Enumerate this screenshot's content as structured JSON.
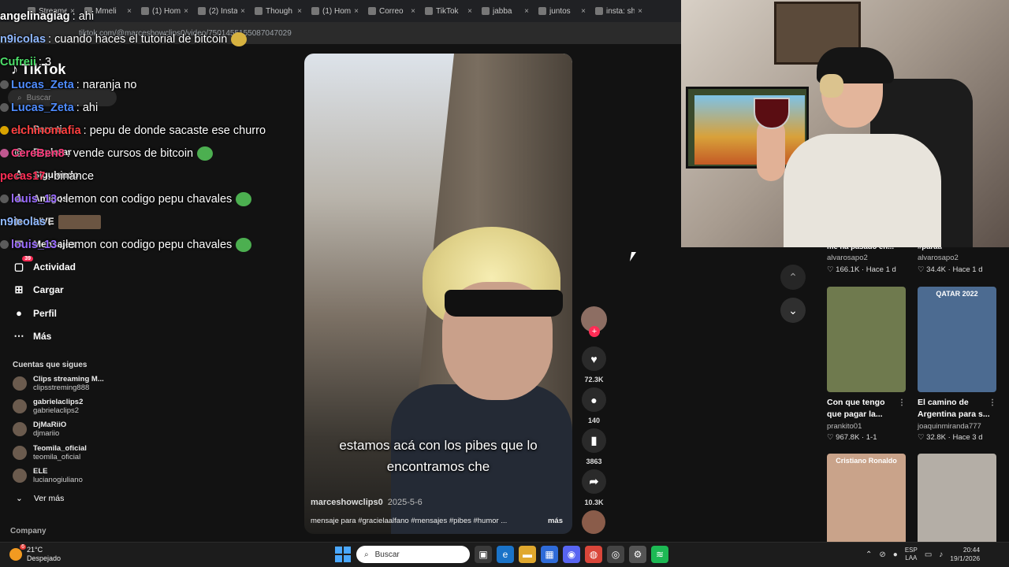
{
  "browser": {
    "tabs": [
      {
        "label": "Streamer",
        "icon": "green-tab-icon"
      },
      {
        "label": "Mmeli",
        "icon": "zz-tab-icon"
      },
      {
        "label": "(1) Hom",
        "icon": "x-tab-icon"
      },
      {
        "label": "(2) Insta",
        "icon": "instagram-tab-icon"
      },
      {
        "label": "Though",
        "icon": "tiktok-tab-icon"
      },
      {
        "label": "(1) Hom",
        "icon": "x-tab-icon"
      },
      {
        "label": "Correo",
        "icon": "tiktok-tab-icon"
      },
      {
        "label": "TikTok",
        "icon": "tiktok-tab-icon"
      },
      {
        "label": "jabba",
        "icon": "google-tab-icon"
      },
      {
        "label": "juntos",
        "icon": "tiktok-tab-icon"
      },
      {
        "label": "insta: sh",
        "icon": "tiktok-tab-icon"
      }
    ],
    "address": "tiktok.com/@marceshowclips0/video/7501455155087047029"
  },
  "tiktok": {
    "logo": "TikTok",
    "search_placeholder": "Buscar",
    "nav": [
      {
        "label": "Para ti",
        "icon": "home-icon"
      },
      {
        "label": "Explorar",
        "icon": "compass-icon"
      },
      {
        "label": "Siguiendo",
        "icon": "following-icon"
      },
      {
        "label": "Amigos",
        "icon": "friends-icon"
      },
      {
        "label": "LIVE",
        "icon": "live-icon"
      },
      {
        "label": "Mensajes",
        "icon": "messages-icon"
      },
      {
        "label": "Actividad",
        "icon": "activity-icon",
        "badge": "39"
      },
      {
        "label": "Cargar",
        "icon": "upload-icon"
      },
      {
        "label": "Perfil",
        "icon": "profile-icon"
      },
      {
        "label": "Más",
        "icon": "more-icon"
      }
    ],
    "following_title": "Cuentas que sigues",
    "following": [
      {
        "name": "Clips streaming M...",
        "handle": "clipsstreming888"
      },
      {
        "name": "gabrielaclips2",
        "handle": "gabrielaclips2"
      },
      {
        "name": "DjMaRiiO",
        "handle": "djmariio",
        "verified": true
      },
      {
        "name": "Teomila_oficial",
        "handle": "teomila_oficial"
      },
      {
        "name": "ELE",
        "handle": "lucianogiuliano"
      }
    ],
    "see_more": "Ver más",
    "company": "Company"
  },
  "chat": [
    {
      "user": "angelinagiag",
      "color": "#ffffff",
      "message": "ahi",
      "badge": "none"
    },
    {
      "user": "n9icolas",
      "color": "#8fb8ff",
      "message": "cuando haces el tutorial de bitcoin",
      "emote": "yellow",
      "badge": "none"
    },
    {
      "user": "Cufreii",
      "color": "#4de06a",
      "message": "3",
      "badge": "none"
    },
    {
      "user": "Lucas_Zeta",
      "color": "#4f8cff",
      "message": "naranja no",
      "badge": "gray"
    },
    {
      "user": "Lucas_Zeta",
      "color": "#4f8cff",
      "message": "ahi",
      "badge": "gray"
    },
    {
      "user": "elchinomafia",
      "color": "#ff4040",
      "message": "pepu de donde sacaste ese churro",
      "badge": "gold"
    },
    {
      "user": "CereBen8",
      "color": "#ff3e7f",
      "message": "vende cursos de bitcoin",
      "emote": "green",
      "badge": "pink"
    },
    {
      "user": "pecas17",
      "color": "#ff2d55",
      "message": "binance",
      "badge": "none"
    },
    {
      "user": "louis_13",
      "color": "#9a6bff",
      "message": "lemon con codigo pepu chavales",
      "emote": "green",
      "badge": "gray"
    },
    {
      "user": "n9icolas",
      "color": "#8fb8ff",
      "message": "",
      "emote": "box",
      "badge": "none"
    },
    {
      "user": "louis_13",
      "color": "#9a6bff",
      "message": "lemon con codigo pepu chavales",
      "emote": "green",
      "badge": "gray"
    }
  ],
  "video": {
    "subtitle_line1": "estamos acá con los pibes que lo",
    "subtitle_line2": "encontramos che",
    "author": "marceshowclips0",
    "date": "2025-5-6",
    "caption": "mensaje para #gracielaalfano #mensajes #pibes #humor ...",
    "more": "más",
    "likes": "72.3K",
    "comments": "140",
    "saves": "3863",
    "shares": "10.3K"
  },
  "related": {
    "top_left": {
      "title": "me ha pasado en...",
      "author": "alvarosapo2",
      "likes": "166.1K",
      "age": "Hace 1 d"
    },
    "top_right": {
      "title": "#parati",
      "author": "alvarosapo2",
      "likes": "34.4K",
      "age": "Hace 1 d"
    },
    "cards": [
      {
        "title_line1": "Con que tengo",
        "title_line2": "que pagar la...",
        "author": "prankito01",
        "likes": "967.8K",
        "age": "1-1",
        "tag": "",
        "thumb_color": "#6f7a4e"
      },
      {
        "title_line1": "El camino de",
        "title_line2": "Argentina para s...",
        "author": "joaquinmiranda777",
        "likes": "32.8K",
        "age": "Hace 3 d",
        "tag": "QATAR 2022",
        "thumb_color": "#4c6b91"
      },
      {
        "title_line1": "",
        "title_line2": "",
        "author": "",
        "likes": "",
        "age": "",
        "tag": "Cristiano Ronaldo",
        "thumb_color": "#c9a38a"
      },
      {
        "title_line1": "",
        "title_line2": "",
        "author": "",
        "likes": "",
        "age": "",
        "tag": "",
        "thumb_color": "#b4aea6"
      }
    ]
  },
  "taskbar": {
    "weather_temp": "21°C",
    "weather_desc": "Despejado",
    "weather_badge": "6",
    "search": "Buscar",
    "lang_top": "ESP",
    "lang_bottom": "LAA",
    "time": "20:44",
    "date": "19/1/2026"
  }
}
